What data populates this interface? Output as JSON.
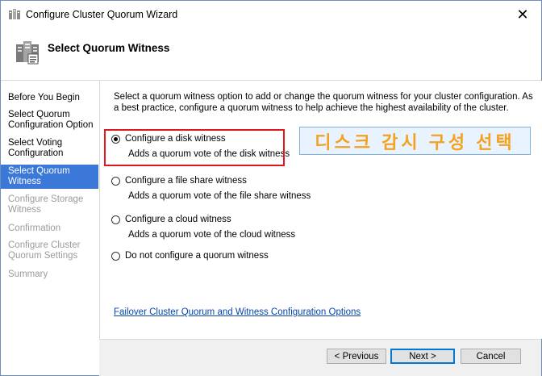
{
  "window": {
    "title": "Configure Cluster Quorum Wizard",
    "close_glyph": "✕"
  },
  "header": {
    "title": "Select Quorum Witness"
  },
  "sidebar": {
    "items": [
      {
        "label": "Before You Begin",
        "state": "normal"
      },
      {
        "label": "Select Quorum Configuration Option",
        "state": "normal"
      },
      {
        "label": "Select Voting Configuration",
        "state": "normal"
      },
      {
        "label": "Select Quorum Witness",
        "state": "active"
      },
      {
        "label": "Configure Storage Witness",
        "state": "disabled"
      },
      {
        "label": "Confirmation",
        "state": "disabled"
      },
      {
        "label": "Configure Cluster Quorum Settings",
        "state": "disabled"
      },
      {
        "label": "Summary",
        "state": "disabled"
      }
    ]
  },
  "main": {
    "description": "Select a quorum witness option to add or change the quorum witness for your cluster configuration. As a best practice, configure a quorum witness to help achieve the highest availability of the cluster.",
    "options": [
      {
        "label": "Configure a disk witness",
        "sub": "Adds a quorum vote of the disk witness",
        "selected": true
      },
      {
        "label": "Configure a file share witness",
        "sub": "Adds a quorum vote of the file share witness",
        "selected": false
      },
      {
        "label": "Configure a cloud witness",
        "sub": "Adds a quorum vote of the cloud witness",
        "selected": false
      },
      {
        "label": "Do not configure a quorum witness",
        "sub": "",
        "selected": false
      }
    ],
    "help_link": "Failover Cluster Quorum and Witness Configuration Options"
  },
  "annotation": {
    "text": "디스크 감시 구성 선택",
    "color": "#f4a21e",
    "box_color": "#e0171c"
  },
  "footer": {
    "previous_label": "< Previous",
    "next_label": "Next >",
    "cancel_label": "Cancel"
  },
  "colors": {
    "active_nav": "#3b78d8",
    "link": "#0645ad"
  }
}
